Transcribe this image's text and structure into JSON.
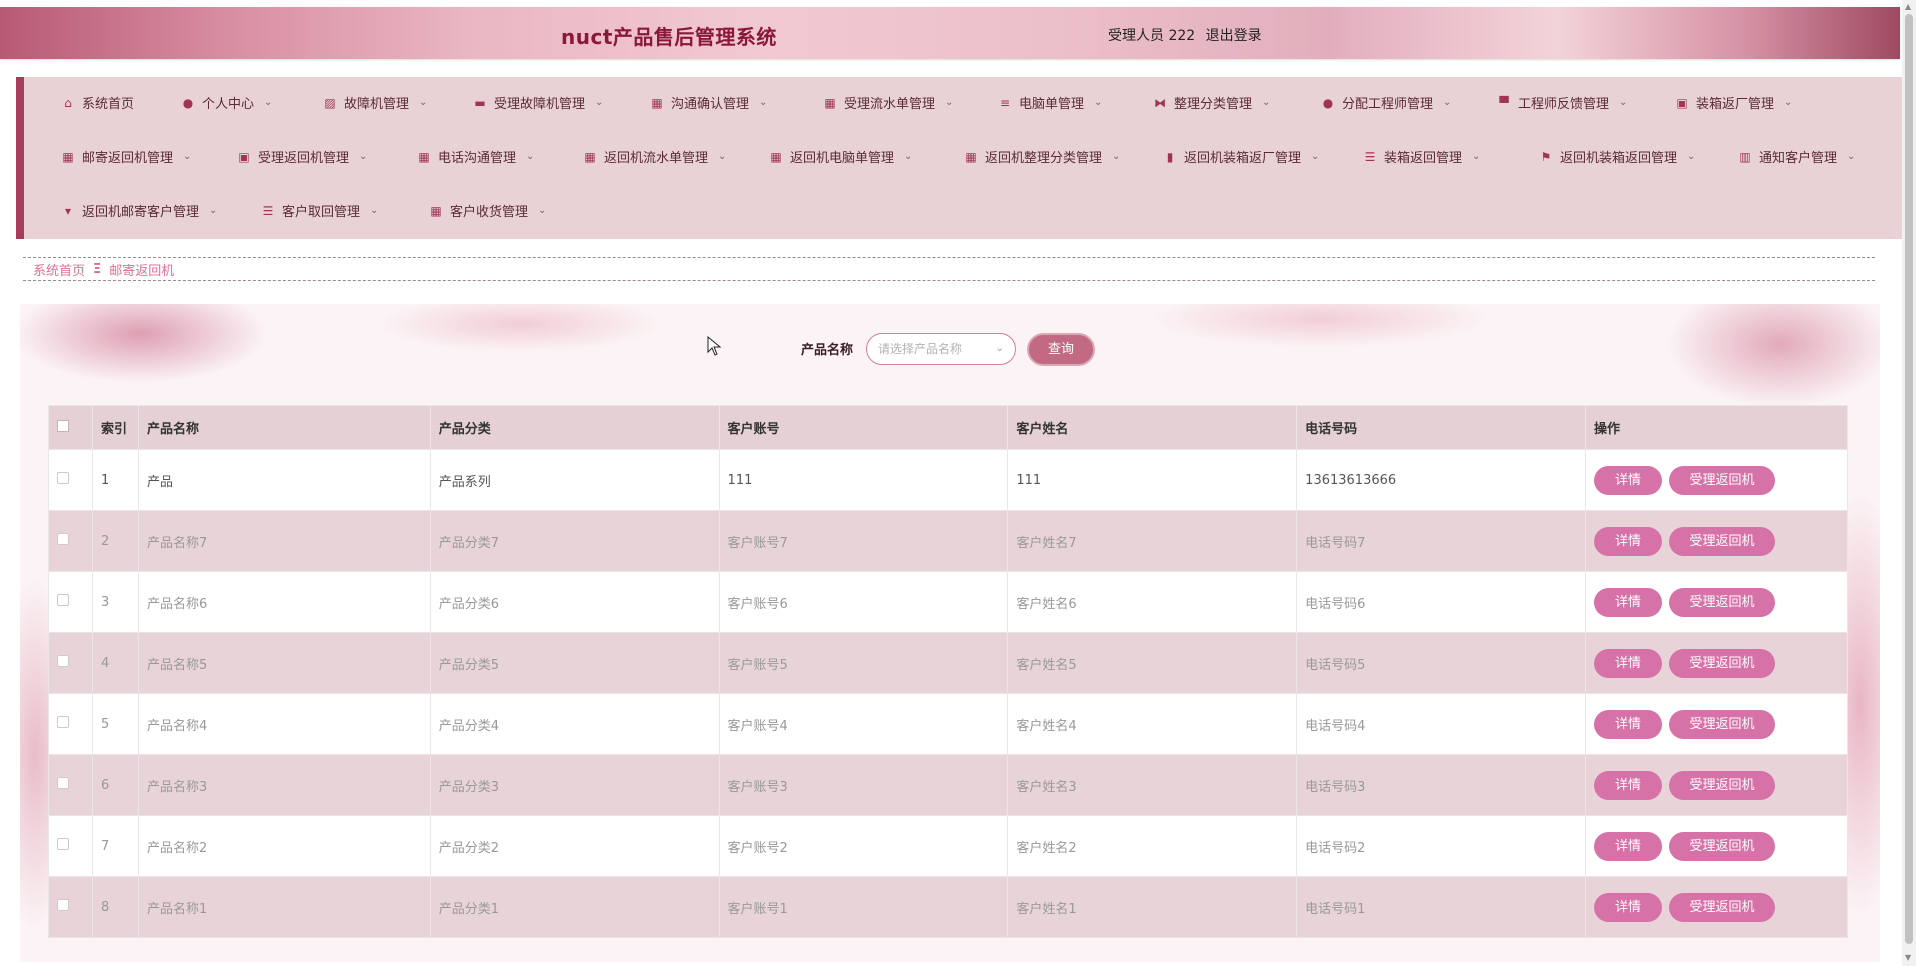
{
  "header": {
    "title": "nuct产品售后管理系统",
    "user_label": "受理人员 222",
    "logout_label": "退出登录"
  },
  "nav": {
    "items": [
      {
        "label": "系统首页",
        "icon": "home-icon",
        "has_menu": false
      },
      {
        "label": "个人中心",
        "icon": "user-icon",
        "has_menu": true
      },
      {
        "label": "故障机管理",
        "icon": "chart-icon",
        "has_menu": true
      },
      {
        "label": "受理故障机管理",
        "icon": "comment-icon",
        "has_menu": true
      },
      {
        "label": "沟通确认管理",
        "icon": "grid-icon",
        "has_menu": true
      },
      {
        "label": "受理流水单管理",
        "icon": "grid-icon",
        "has_menu": true
      },
      {
        "label": "电脑单管理",
        "icon": "sliders-icon",
        "has_menu": true
      },
      {
        "label": "整理分类管理",
        "icon": "bowtie-icon",
        "has_menu": true
      },
      {
        "label": "分配工程师管理",
        "icon": "user-icon",
        "has_menu": true
      },
      {
        "label": "工程师反馈管理",
        "icon": "desk-icon",
        "has_menu": true
      },
      {
        "label": "装箱返厂管理",
        "icon": "clipboard-icon",
        "has_menu": true
      },
      {
        "label": "邮寄返回机管理",
        "icon": "grid-icon",
        "has_menu": true
      },
      {
        "label": "受理返回机管理",
        "icon": "clipboard-check-icon",
        "has_menu": true
      },
      {
        "label": "电话沟通管理",
        "icon": "grid-icon",
        "has_menu": true
      },
      {
        "label": "返回机流水单管理",
        "icon": "grid-icon",
        "has_menu": true
      },
      {
        "label": "返回机电脑单管理",
        "icon": "grid-icon",
        "has_menu": true
      },
      {
        "label": "返回机整理分类管理",
        "icon": "grid9-icon",
        "has_menu": true
      },
      {
        "label": "返回机装箱返厂管理",
        "icon": "bar-chart-icon",
        "has_menu": true
      },
      {
        "label": "装箱返回管理",
        "icon": "list-icon",
        "has_menu": true
      },
      {
        "label": "返回机装箱返回管理",
        "icon": "flag-icon",
        "has_menu": true
      },
      {
        "label": "通知客户管理",
        "icon": "book-icon",
        "has_menu": true
      },
      {
        "label": "返回机邮寄客户管理",
        "icon": "brush-icon",
        "has_menu": true
      },
      {
        "label": "客户取回管理",
        "icon": "list-icon",
        "has_menu": true
      },
      {
        "label": "客户收货管理",
        "icon": "grid-icon",
        "has_menu": true
      }
    ]
  },
  "breadcrumb": {
    "home": "系统首页",
    "separator": "Ξ",
    "current": "邮寄返回机"
  },
  "search": {
    "label": "产品名称",
    "placeholder": "请选择产品名称",
    "button": "查询"
  },
  "table": {
    "columns": [
      "索引",
      "产品名称",
      "产品分类",
      "客户账号",
      "客户姓名",
      "电话号码",
      "操作"
    ],
    "rows": [
      [
        "1",
        "产品",
        "产品系列",
        "111",
        "111",
        "13613613666"
      ],
      [
        "2",
        "产品名称7",
        "产品分类7",
        "客户账号7",
        "客户姓名7",
        "电话号码7"
      ],
      [
        "3",
        "产品名称6",
        "产品分类6",
        "客户账号6",
        "客户姓名6",
        "电话号码6"
      ],
      [
        "4",
        "产品名称5",
        "产品分类5",
        "客户账号5",
        "客户姓名5",
        "电话号码5"
      ],
      [
        "5",
        "产品名称4",
        "产品分类4",
        "客户账号4",
        "客户姓名4",
        "电话号码4"
      ],
      [
        "6",
        "产品名称3",
        "产品分类3",
        "客户账号3",
        "客户姓名3",
        "电话号码3"
      ],
      [
        "7",
        "产品名称2",
        "产品分类2",
        "客户账号2",
        "客户姓名2",
        "电话号码2"
      ],
      [
        "8",
        "产品名称1",
        "产品分类1",
        "客户账号1",
        "客户姓名1",
        "电话号码1"
      ]
    ],
    "actions": {
      "detail": "详情",
      "handle": "受理返回机"
    }
  },
  "colors": {
    "accent": "#a63d5c",
    "title": "#8a1838",
    "button": "#d672a7",
    "nav_bg": "#e8d2d6",
    "header_row": "#e5d1d5"
  }
}
